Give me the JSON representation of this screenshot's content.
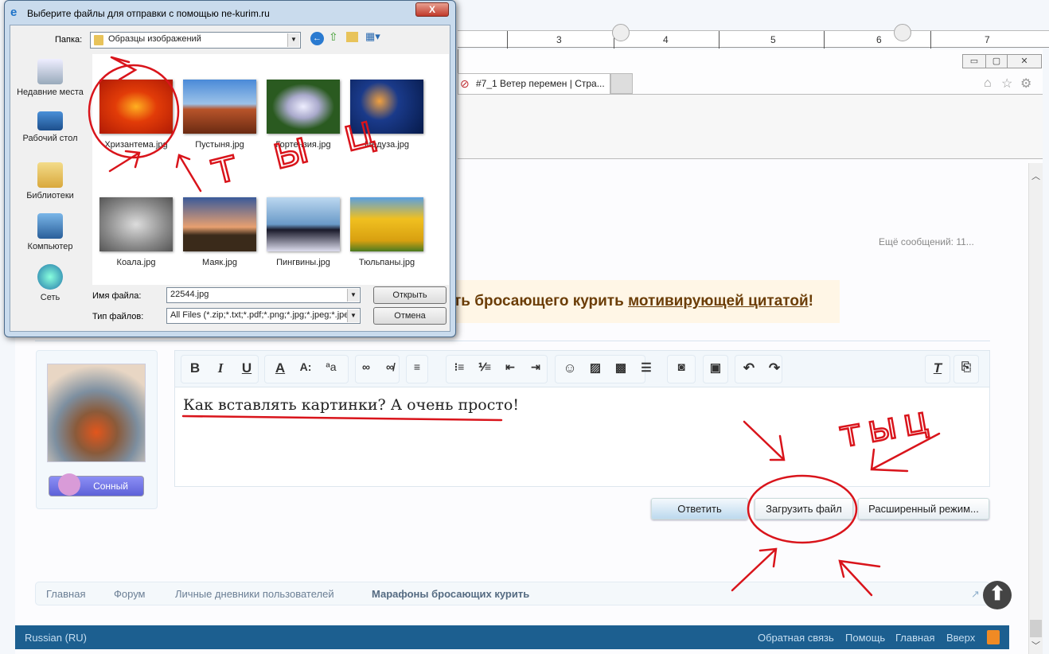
{
  "ruler": {
    "numbers": [
      "3",
      "4",
      "5",
      "6",
      "7"
    ]
  },
  "browser": {
    "tab_title": "#7_1 Ветер перемен | Стра...",
    "tab_close": "×",
    "minimize": "▭",
    "restore": "▢",
    "close": "✕"
  },
  "page": {
    "more_messages": "Ещё сообщений: 11...",
    "banner_prefix": "ть бросающего курить ",
    "banner_link": "мотивирующей цитатой",
    "banner_suffix": "!",
    "mood_label": "Сонный",
    "editor_text": "Как вставлять картинки? А очень просто!",
    "toolbar": {
      "bold": "B",
      "italic": "I",
      "underline": "U",
      "font_color": "A",
      "font_size": "A:",
      "font_family": "ªa"
    },
    "buttons": {
      "reply": "Ответить",
      "upload": "Загрузить файл",
      "advanced": "Расширенный режим..."
    },
    "breadcrumb": [
      "Главная",
      "Форум",
      "Личные дневники пользователей",
      "Марафоны бросающих курить"
    ],
    "footer": {
      "language": "Russian (RU)",
      "links": [
        "Обратная связь",
        "Помощь",
        "Главная",
        "Вверх"
      ]
    }
  },
  "dialog": {
    "title": "Выберите файлы для отправки с помощью ne-kurim.ru",
    "close": "X",
    "folder_label": "Папка:",
    "folder_value": "Образцы изображений",
    "places": [
      "Недавние места",
      "Рабочий стол",
      "Библиотеки",
      "Компьютер",
      "Сеть"
    ],
    "files": [
      "Хризантема.jpg",
      "Пустыня.jpg",
      "Гортензия.jpg",
      "Медуза.jpg",
      "Коала.jpg",
      "Маяк.jpg",
      "Пингвины.jpg",
      "Тюльпаны.jpg"
    ],
    "filename_label": "Имя файла:",
    "filename_value": "22544.jpg",
    "filetype_label": "Тип файлов:",
    "filetype_value": "All Files (*.zip;*.txt;*.pdf;*.png;*.jpg;*.jpeg;*.jpe;*.",
    "open": "Открыть",
    "cancel": "Отмена"
  },
  "annotations": [
    "тыц",
    "тыц"
  ],
  "colors": {
    "footer": "#1c5f90",
    "annotation": "#d9141b",
    "banner_bg": "#fff6e6"
  }
}
